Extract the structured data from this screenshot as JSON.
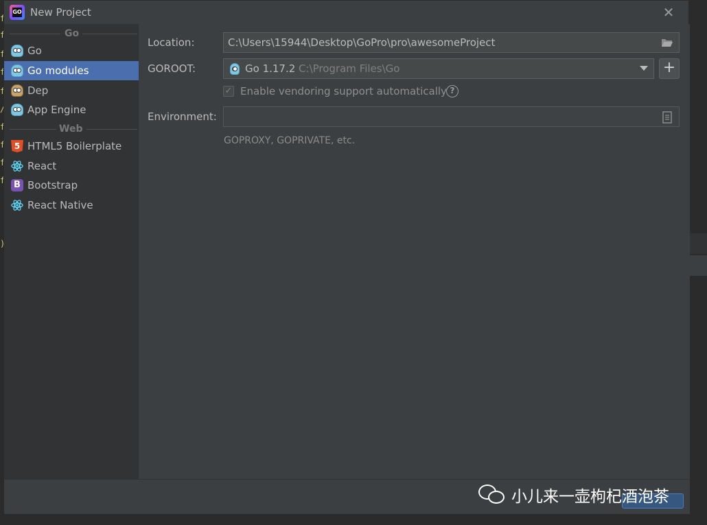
{
  "background": {
    "editor_chars": [
      "f",
      "f",
      "f",
      "f",
      "f",
      "/",
      "f",
      "f",
      "f",
      "f",
      ")"
    ]
  },
  "dialog": {
    "title": "New Project",
    "app_icon": "GO",
    "close_icon": "close-icon"
  },
  "sidebar": {
    "groups": [
      {
        "label": "Go"
      },
      {
        "label": "Web"
      }
    ],
    "items": [
      {
        "label": "Go",
        "icon": "gopher-icon"
      },
      {
        "label": "Go modules",
        "icon": "gopher-icon",
        "selected": true
      },
      {
        "label": "Dep",
        "icon": "gopher-dep-icon"
      },
      {
        "label": "App Engine",
        "icon": "app-engine-gopher-icon"
      },
      {
        "label": "HTML5 Boilerplate",
        "icon": "html5-icon",
        "icon_text": "5"
      },
      {
        "label": "React",
        "icon": "react-icon"
      },
      {
        "label": "Bootstrap",
        "icon": "bootstrap-icon",
        "icon_text": "B"
      },
      {
        "label": "React Native",
        "icon": "react-icon"
      }
    ]
  },
  "form": {
    "location_label": "Location:",
    "location_value": "C:\\Users\\15944\\Desktop\\GoPro\\pro\\awesomeProject",
    "goroot_label": "GOROOT:",
    "goroot_version": "Go 1.17.2",
    "goroot_path": " C:\\Program Files\\Go",
    "add_sdk_label": "+",
    "vendoring_label": "Enable vendoring support automatically",
    "vendoring_checked": true,
    "help_label": "?",
    "environment_label": "Environment:",
    "environment_value": "",
    "environment_hint": "GOPROXY, GOPRIVATE, etc."
  },
  "watermark": {
    "text": "小儿来一壶枸杞酒泡茶"
  },
  "colors": {
    "dialog_bg": "#3c3f41",
    "sidebar_bg": "#313335",
    "selection": "#4b6eaf",
    "field_bg": "#45494a"
  }
}
